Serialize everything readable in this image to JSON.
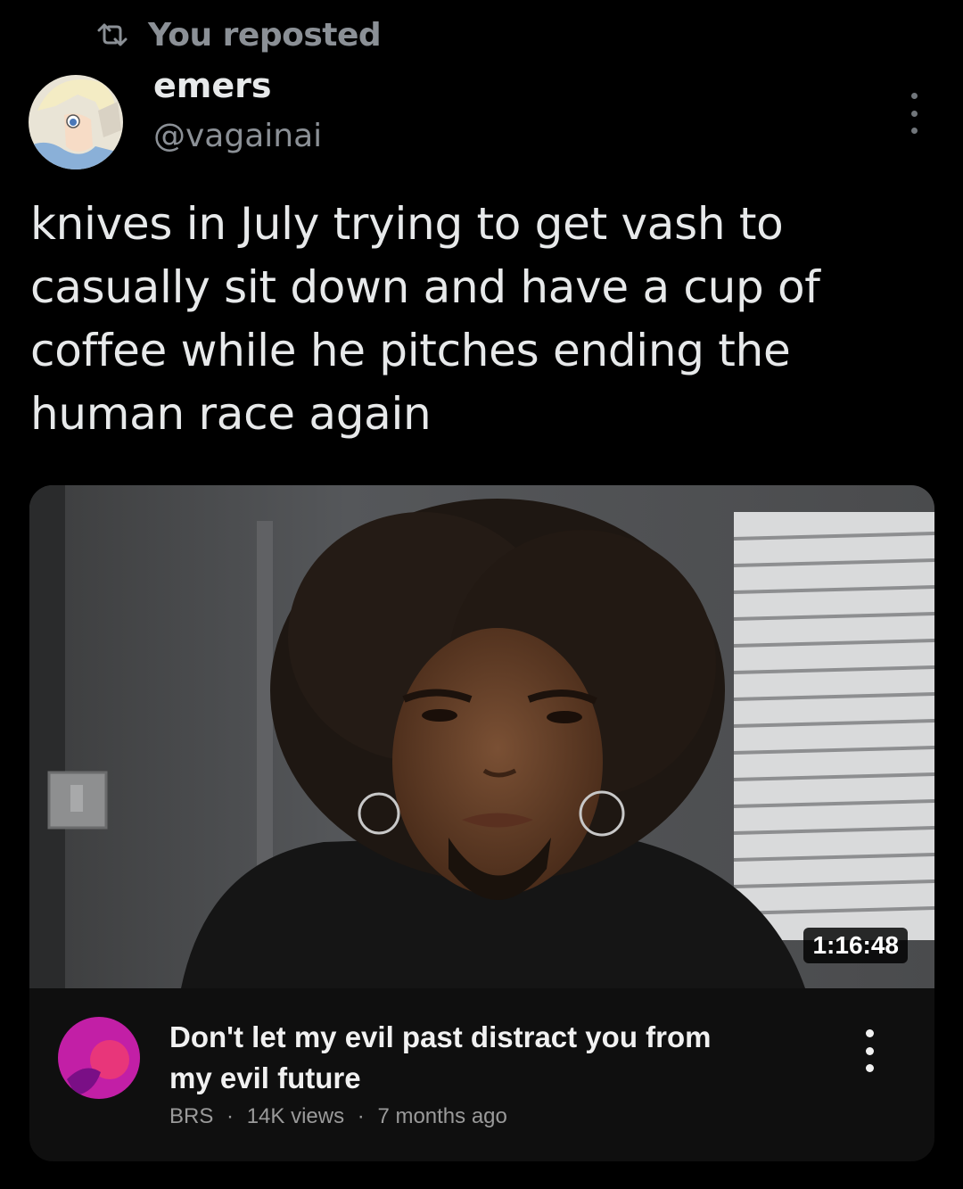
{
  "repost": {
    "icon": "repost-icon",
    "label": "You reposted"
  },
  "author": {
    "display_name": "emers",
    "handle": "@vagainai",
    "avatar_icon": "avatar-image"
  },
  "menu": {
    "icon": "more-vertical-icon"
  },
  "post": {
    "lines": [
      "knives in July trying to get vash to",
      "casually sit down and have a cup of",
      "coffee while he pitches ending the",
      "human race again"
    ]
  },
  "video": {
    "duration": "1:16:48",
    "title_lines": [
      "Don't let my evil past distract you from",
      "my evil future"
    ],
    "channel": "BRS",
    "views": "14K views",
    "age": "7 months ago",
    "separator": "·",
    "menu_icon": "more-vertical-icon"
  },
  "colors": {
    "background": "#000000",
    "text": "#e7e9ea",
    "muted": "#8b9096",
    "video_bg": "#0f0f0f",
    "channel_avatar": "#c21fa6"
  }
}
